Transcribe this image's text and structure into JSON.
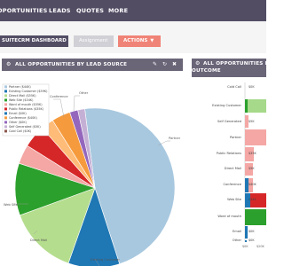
{
  "nav": {
    "items": [
      "OPORTUNITIES",
      "LEADS",
      "QUOTES",
      "MORE"
    ]
  },
  "tabs": {
    "dashboard": "SUITECRM DASHBOARD",
    "assignment": "Assignment",
    "actions": "ACTIONS"
  },
  "dashlet_left": {
    "title": "ALL OPPORTUNITIES BY LEAD SOURCE",
    "legend": [
      {
        "label": "Partner ($44K)",
        "color": "#a8c8df"
      },
      {
        "label": "Existing Customer ($59K)",
        "color": "#1f77b4"
      },
      {
        "label": "Direct Mail ($55K)",
        "color": "#b5dd8e"
      },
      {
        "label": "Web Site ($34K)",
        "color": "#2ca02c"
      },
      {
        "label": "Word of mouth ($55K)",
        "color": "#f4a7a4"
      },
      {
        "label": "Public Relations ($35K)",
        "color": "#d62728"
      },
      {
        "label": "Email ($0K)",
        "color": "#1f77b4"
      },
      {
        "label": "Conference ($40K)",
        "color": "#f59b3e"
      },
      {
        "label": "Other ($0K)",
        "color": "#9467bd"
      },
      {
        "label": "Self Generated ($5K)",
        "color": "#c5b0d5"
      },
      {
        "label": "Cold Call ($0K)",
        "color": "#8c564b"
      }
    ],
    "slice_labels": {
      "partner": "Partner",
      "existing": "Existing Customer",
      "direct": "Direct Mail",
      "web": "Web Site",
      "conference": "Conference",
      "other": "Other"
    }
  },
  "dashlet_right": {
    "title_line1": "ALL OPPORTUNITIES BY",
    "title_line2": "OUTCOME",
    "rows": [
      {
        "label": "Cold Call",
        "value": "$0K"
      },
      {
        "label": "Existing Customer",
        "value": ""
      },
      {
        "label": "Self Generated",
        "value": "$5K"
      },
      {
        "label": "Partner",
        "value": ""
      },
      {
        "label": "Public Relations",
        "value": "$35K"
      },
      {
        "label": "Direct Mail",
        "value": "$5K"
      },
      {
        "label": "Conference",
        "value": "$40K"
      },
      {
        "label": "Web Site",
        "value": "$34K"
      },
      {
        "label": "Word of mouth",
        "value": ""
      },
      {
        "label": "Email",
        "value": "$0K"
      },
      {
        "label": "Other",
        "value": "$0K"
      }
    ],
    "axis_ticks": [
      "$0K",
      "$20K"
    ]
  }
}
